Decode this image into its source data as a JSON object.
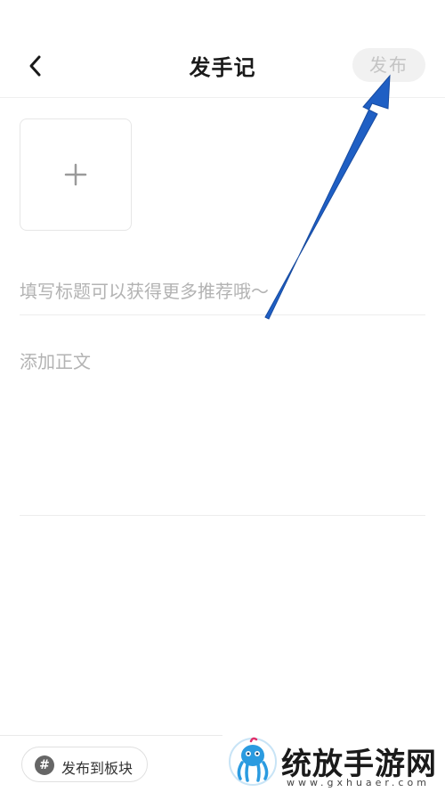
{
  "header": {
    "title": "发手记",
    "back_icon": "chevron-left-icon",
    "publish_label": "发布"
  },
  "editor": {
    "add_image_icon": "plus-icon",
    "title_placeholder": "填写标题可以获得更多推荐哦～",
    "body_placeholder": "添加正文"
  },
  "bottom_bar": {
    "board_icon": "hash-icon",
    "board_icon_glyph": "#",
    "board_label": "发布到板块"
  },
  "watermark": {
    "text": "统放手游网",
    "url": "www.gxhuaer.com",
    "logo_icon": "octopus-logo-icon"
  },
  "annotation": {
    "arrow_color": "#1f5fc4",
    "points_to": "publish-button"
  }
}
